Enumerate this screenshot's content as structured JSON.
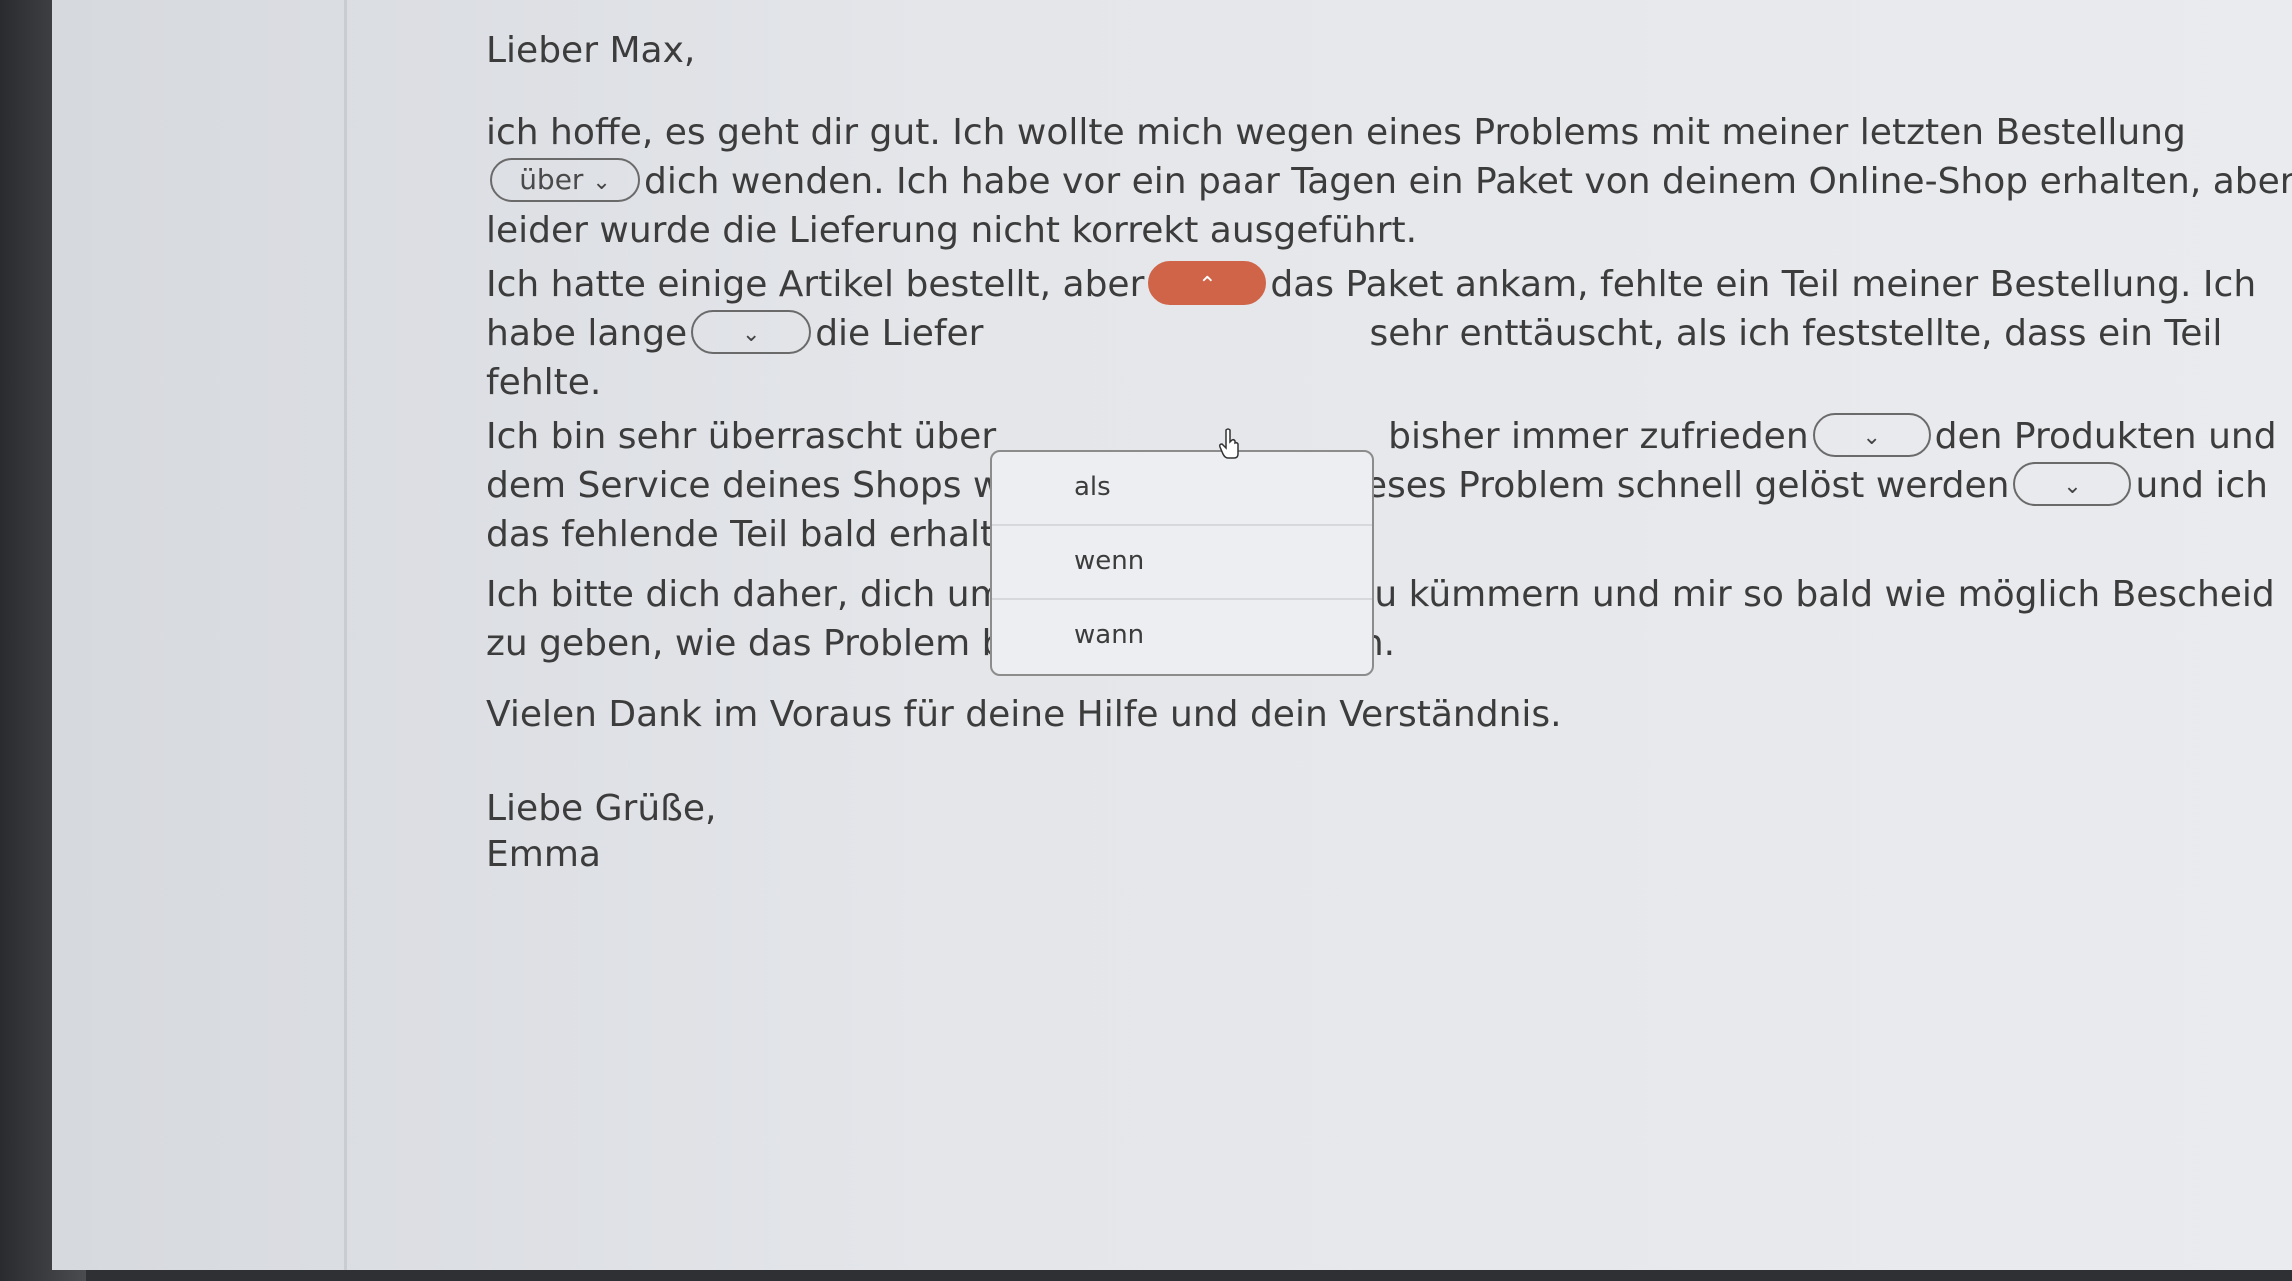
{
  "letter": {
    "greeting": "Lieber Max,",
    "p1": {
      "l1": "ich hoffe, es geht dir gut. Ich wollte mich wegen eines Problems mit meiner letzten Bestellung",
      "gap1_value": "über",
      "l2": "dich wenden. Ich habe vor ein paar Tagen ein Paket von deinem Online-Shop erhalten, aber",
      "l3": "leider wurde die Lieferung nicht korrekt ausgeführt."
    },
    "p2": {
      "l1a": "Ich hatte einige Artikel bestellt, aber",
      "l1b": "das Paket ankam, fehlte ein Teil meiner Bestellung. Ich",
      "l2a": "habe lange",
      "l2b": "die Liefer",
      "l2c": "sehr enttäuscht, als ich feststellte, dass ein Teil",
      "l3": "fehlte."
    },
    "p3": {
      "l1a": "Ich bin sehr überrascht über",
      "l1b": "bisher immer zufrieden",
      "l1c": "den Produkten und",
      "l2a": "dem Service deines Shops war. Ich hoffe, dass dieses Problem schnell gelöst werden",
      "l2b": "und ich",
      "l3": "das fehlende Teil bald erhalten werde."
    },
    "p4": {
      "l1": "Ich bitte dich daher, dich um die Angelegenheit zu kümmern und mir so bald wie möglich Bescheid",
      "l2": "zu geben, wie das Problem behoben werden kann."
    },
    "p5": "Vielen Dank im Voraus für deine Hilfe und dein Verständnis.",
    "closing": "Liebe Grüße,",
    "signature": "Emma"
  },
  "gaps": {
    "chevron_down": "⌄",
    "chevron_up": "⌃"
  },
  "dropdown": {
    "options": [
      "als",
      "wenn",
      "wann"
    ]
  },
  "colors": {
    "accent": "#cf6448",
    "text": "#3c3c3c",
    "page_bg": "#e6e8eb"
  }
}
